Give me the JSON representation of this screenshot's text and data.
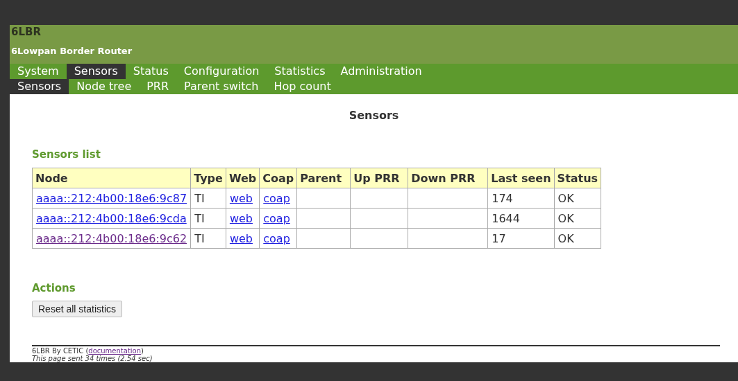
{
  "header": {
    "title": "6LBR",
    "subtitle": "6Lowpan Border Router"
  },
  "menu": [
    {
      "label": "System",
      "selected": false
    },
    {
      "label": "Sensors",
      "selected": true
    },
    {
      "label": "Status",
      "selected": false
    },
    {
      "label": "Configuration",
      "selected": false
    },
    {
      "label": "Statistics",
      "selected": false
    },
    {
      "label": "Administration",
      "selected": false
    }
  ],
  "submenu": [
    {
      "label": "Sensors",
      "selected": true
    },
    {
      "label": "Node tree",
      "selected": false
    },
    {
      "label": "PRR",
      "selected": false
    },
    {
      "label": "Parent switch",
      "selected": false
    },
    {
      "label": "Hop count",
      "selected": false
    }
  ],
  "page_title": "Sensors",
  "sensors_heading": "Sensors list",
  "table": {
    "columns": [
      "Node",
      "Type",
      "Web",
      "Coap",
      "Parent",
      "Up PRR",
      "Down PRR",
      "Last seen",
      "Status"
    ],
    "rows": [
      {
        "node": "aaaa::212:4b00:18e6:9c87",
        "visited": false,
        "type": "TI",
        "web": "web",
        "coap": "coap",
        "last_seen": "174",
        "status": "OK"
      },
      {
        "node": "aaaa::212:4b00:18e6:9cda",
        "visited": false,
        "type": "TI",
        "web": "web",
        "coap": "coap",
        "last_seen": "1644",
        "status": "OK"
      },
      {
        "node": "aaaa::212:4b00:18e6:9c62",
        "visited": true,
        "type": "TI",
        "web": "web",
        "coap": "coap",
        "last_seen": "17",
        "status": "OK"
      }
    ]
  },
  "actions_heading": "Actions",
  "reset_button": "Reset all statistics",
  "footer": {
    "credit_before": "6LBR By CETIC (",
    "link": "documentation",
    "link_visited": true,
    "credit_after": ")",
    "timing": "This page sent 34 times (2.54 sec)"
  }
}
